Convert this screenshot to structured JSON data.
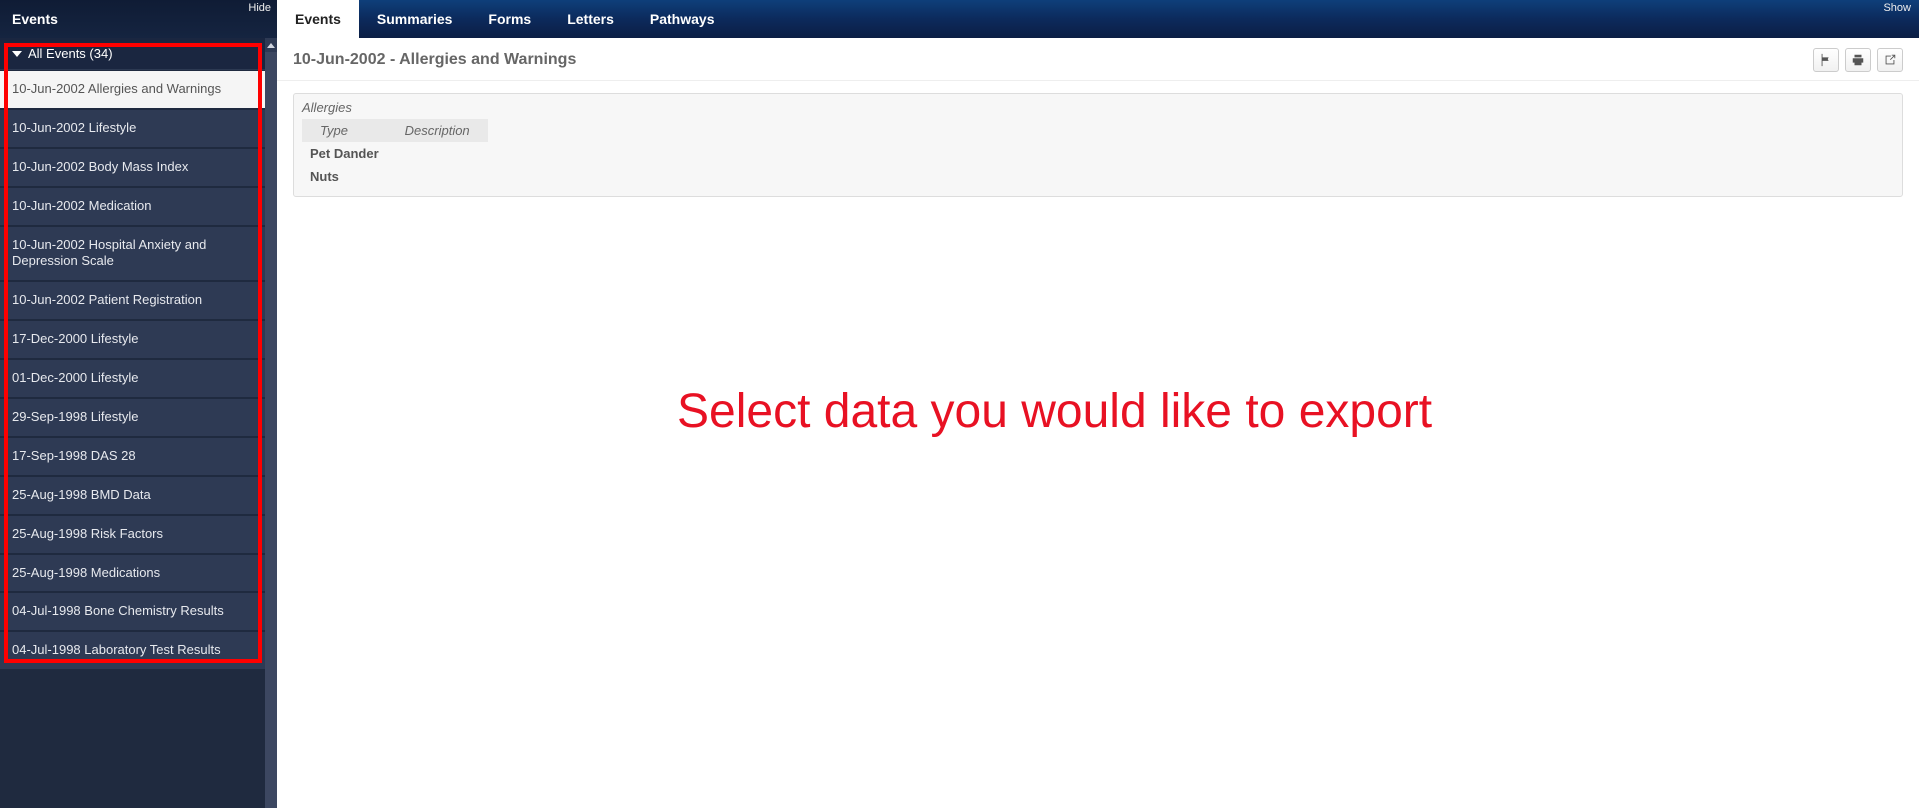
{
  "sidebar": {
    "title": "Events",
    "hide_label": "Hide",
    "all_events_label": "All Events (34)",
    "items": [
      {
        "label": "10-Jun-2002 Allergies and Warnings",
        "selected": true
      },
      {
        "label": "10-Jun-2002 Lifestyle"
      },
      {
        "label": "10-Jun-2002 Body Mass Index"
      },
      {
        "label": "10-Jun-2002 Medication"
      },
      {
        "label": "10-Jun-2002 Hospital Anxiety and Depression Scale"
      },
      {
        "label": "10-Jun-2002 Patient Registration"
      },
      {
        "label": "17-Dec-2000 Lifestyle"
      },
      {
        "label": "01-Dec-2000 Lifestyle"
      },
      {
        "label": "29-Sep-1998 Lifestyle"
      },
      {
        "label": "17-Sep-1998 DAS 28"
      },
      {
        "label": "25-Aug-1998 BMD Data"
      },
      {
        "label": "25-Aug-1998 Risk Factors"
      },
      {
        "label": "25-Aug-1998 Medications"
      },
      {
        "label": "04-Jul-1998 Bone Chemistry Results"
      },
      {
        "label": "04-Jul-1998 Laboratory Test Results"
      }
    ]
  },
  "topnav": {
    "show_label": "Show",
    "tabs": [
      {
        "label": "Events",
        "active": true
      },
      {
        "label": "Summaries"
      },
      {
        "label": "Forms"
      },
      {
        "label": "Letters"
      },
      {
        "label": "Pathways"
      }
    ]
  },
  "content": {
    "title": "10-Jun-2002 - Allergies and Warnings",
    "panel_title": "Allergies",
    "columns": {
      "type": "Type",
      "description": "Description"
    },
    "rows": [
      {
        "type": "Pet Dander",
        "description": ""
      },
      {
        "type": "Nuts",
        "description": ""
      }
    ]
  },
  "annotation": "Select data you would like to export"
}
